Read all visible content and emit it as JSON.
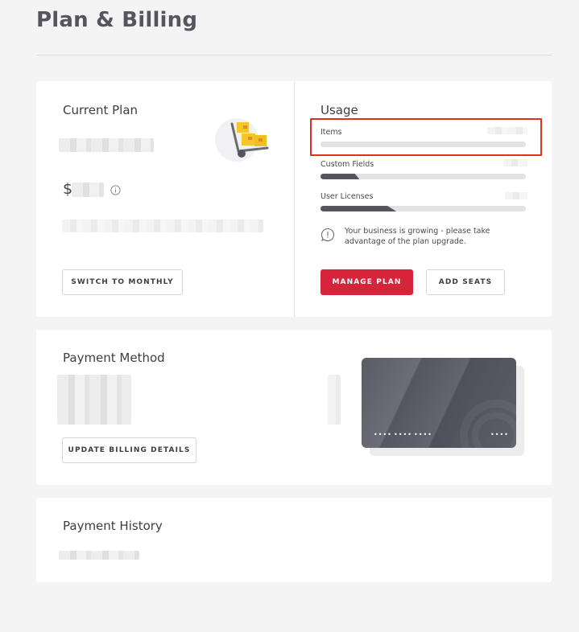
{
  "page": {
    "title": "Plan & Billing"
  },
  "plan": {
    "title": "Current Plan",
    "currency_symbol": "$",
    "switch_label": "SWITCH TO MONTHLY"
  },
  "usage": {
    "title": "Usage",
    "items": [
      {
        "label": "Items",
        "fill": 0.0
      },
      {
        "label": "Custom Fields",
        "fill": 0.19
      },
      {
        "label": "User Licenses",
        "fill": 0.37
      }
    ],
    "notice": "Your business is growing - please take advantage of the plan upgrade.",
    "manage_label": "MANAGE PLAN",
    "add_seats_label": "ADD SEATS"
  },
  "payment": {
    "title": "Payment Method",
    "update_label": "UPDATE BILLING DETAILS",
    "card_groups": [
      "••••",
      "••••",
      "••••",
      "••••"
    ]
  },
  "history": {
    "title": "Payment History"
  },
  "colors": {
    "accent": "#d6253a",
    "bar_fill": "#55555d",
    "highlight": "#e0321a"
  }
}
